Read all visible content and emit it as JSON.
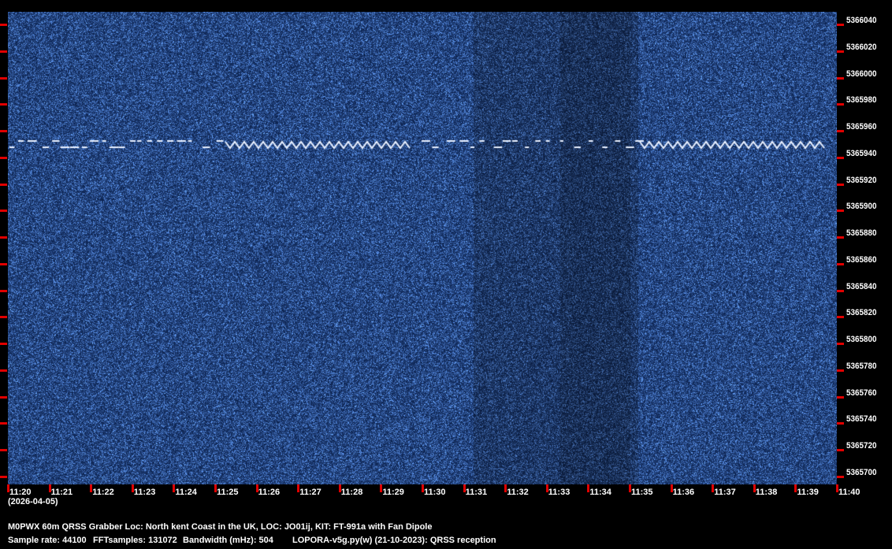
{
  "waterfall": {
    "title": "QRSS waterfall spectrogram",
    "colors": {
      "background": "#1a3f8c",
      "signal": "#ffffff",
      "tick": "#e00000"
    }
  },
  "y_axis": {
    "labels": [
      "5366040",
      "5366020",
      "5366000",
      "5365980",
      "5365960",
      "5365940",
      "5365920",
      "5365900",
      "5365880",
      "5365860",
      "5365840",
      "5365820",
      "5365800",
      "5365780",
      "5365760",
      "5365740",
      "5365720",
      "5365700"
    ]
  },
  "x_axis": {
    "labels": [
      "11:20",
      "11:21",
      "11:22",
      "11:23",
      "11:24",
      "11:25",
      "11:26",
      "11:27",
      "11:28",
      "11:29",
      "11:30",
      "11:31",
      "11:32",
      "11:33",
      "11:34",
      "11:35",
      "11:36",
      "11:37",
      "11:38",
      "11:39",
      "11:40"
    ],
    "date": "(2026-04-05)"
  },
  "footer": {
    "station": "M0PWX 60m QRSS Grabber Loc: North kent Coast in the UK, LOC: JO01ij, KIT: FT-991a with Fan Dipole",
    "sample_rate": "Sample rate: 44100",
    "fft": "FFTsamples: 131072",
    "bandwidth": "Bandwidth (mHz): 504",
    "software": "LOPORA-v5g.py(w) (21-10-2023): QRSS reception"
  }
}
